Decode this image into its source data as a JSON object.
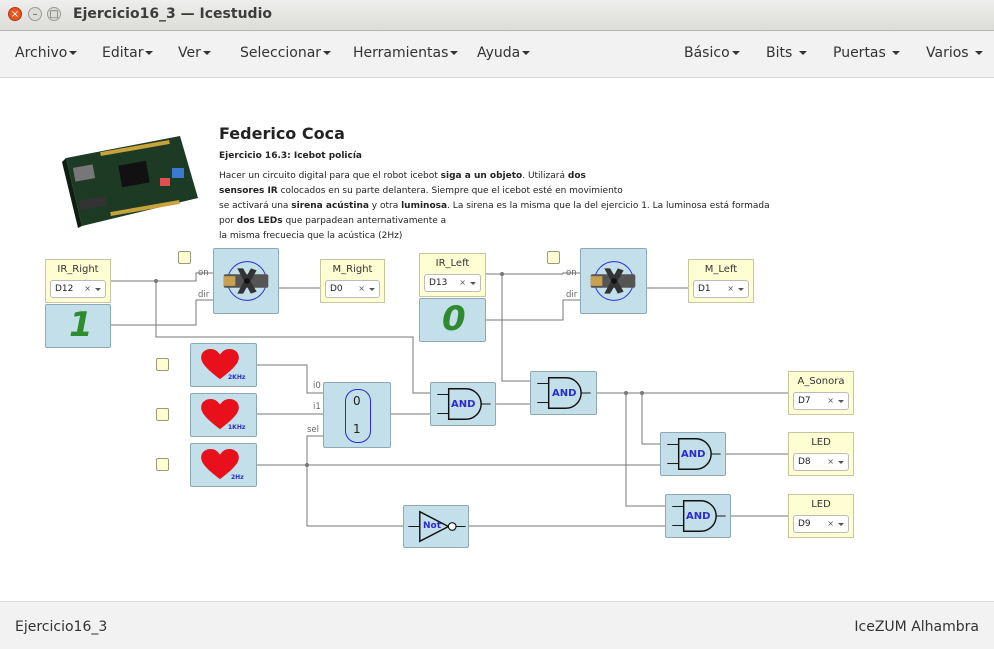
{
  "window": {
    "title": "Ejercicio16_3 — Icestudio"
  },
  "menu": {
    "left": [
      "Archivo",
      "Editar",
      "Ver",
      "Seleccionar",
      "Herramientas",
      "Ayuda"
    ],
    "right": [
      "Básico",
      "Bits",
      "Puertas",
      "Varios"
    ]
  },
  "info": {
    "author": "Federico Coca",
    "subtitle_bold": "Ejercicio 16.3",
    "subtitle_rest": ": Icebot policía",
    "desc": {
      "l1_a": "Hacer un circuito digital para que el robot icebot ",
      "l1_b": "siga a un objeto",
      "l1_c": ". Utilizará ",
      "l1_d": "dos",
      "l2_a": "sensores IR",
      "l2_b": " colocados en su parte delantera. Siempre que el icebot esté en movimiento",
      "l3_a": "se activará una ",
      "l3_b": "sirena acústina",
      "l3_c": " y otra ",
      "l3_d": "luminosa",
      "l3_e": ". La sirena es la misma que la del ejercicio 1. La luminosa está formada",
      "l4_a": "por ",
      "l4_b": "dos LEDs",
      "l4_c": " que parpadean anternativamente a",
      "l5": "la misma frecuecia que la acústica (2Hz)"
    }
  },
  "pins": {
    "ir_right": {
      "name": "IR_Right",
      "value": "D12"
    },
    "m_right": {
      "name": "M_Right",
      "value": "D0"
    },
    "ir_left": {
      "name": "IR_Left",
      "value": "D13"
    },
    "m_left": {
      "name": "M_Left",
      "value": "D1"
    },
    "a_sonora": {
      "name": "A_Sonora",
      "value": "D7"
    },
    "led1": {
      "name": "LED",
      "value": "D8"
    },
    "led2": {
      "name": "LED",
      "value": "D9"
    },
    "clear": "×"
  },
  "blocks": {
    "digit_right": "1",
    "digit_left": "0",
    "servo_on": "on",
    "servo_dir": "dir",
    "heart1": "2KHz",
    "heart2": "1KHz",
    "heart3": "2Hz",
    "mux_i0": "i0",
    "mux_i1": "i1",
    "mux_sel": "sel",
    "mux_0": "0",
    "mux_1": "1",
    "and_label": "AND",
    "not_label": "Not"
  },
  "footer": {
    "left": "Ejercicio16_3",
    "right": "IceZUM Alhambra"
  },
  "colors": {
    "block": "#c3dfea",
    "pin": "#fffed2",
    "accent": "#e95420",
    "gate_text": "#2b2bd0",
    "digit": "#2e8b2e",
    "heart": "#e8101a"
  }
}
